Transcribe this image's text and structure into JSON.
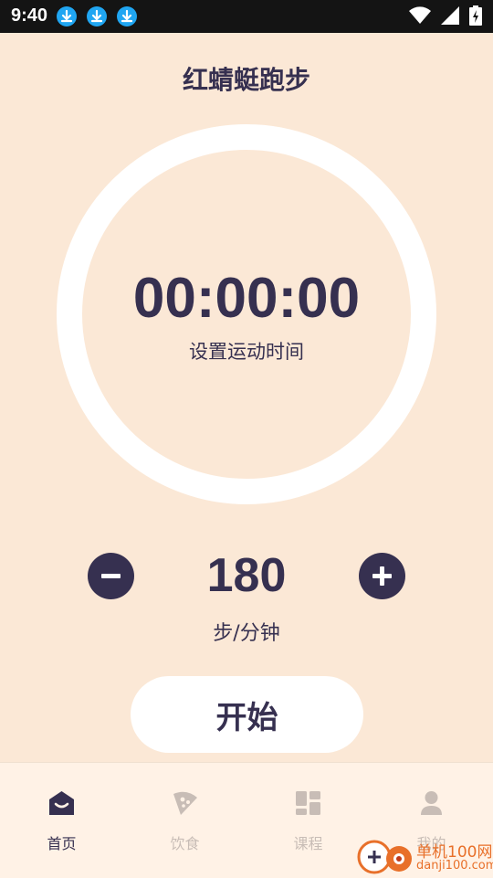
{
  "status_bar": {
    "time": "9:40",
    "icons": [
      "download-icon",
      "download-icon",
      "download-icon",
      "wifi-icon",
      "signal-icon",
      "battery-charging-icon"
    ]
  },
  "header": {
    "title": "红蜻蜓跑步"
  },
  "timer": {
    "display": "00:00:00",
    "caption": "设置运动时间"
  },
  "cadence": {
    "value": "180",
    "unit": "步/分钟",
    "decrease_icon": "minus-icon",
    "increase_icon": "plus-icon"
  },
  "start_button": {
    "label": "开始"
  },
  "bottom_nav": {
    "items": [
      {
        "label": "首页",
        "icon": "home-icon",
        "active": true
      },
      {
        "label": "饮食",
        "icon": "pizza-icon",
        "active": false
      },
      {
        "label": "课程",
        "icon": "grid-icon",
        "active": false
      },
      {
        "label": "我的",
        "icon": "user-icon",
        "active": false
      }
    ]
  },
  "watermark": {
    "line1": "单机100网",
    "line2": "danji100.com"
  },
  "colors": {
    "background": "#fbe8d6",
    "accent": "#363050",
    "nav_background": "#fff2e6",
    "inactive": "#c8bdb6",
    "status_bar": "#141414"
  }
}
